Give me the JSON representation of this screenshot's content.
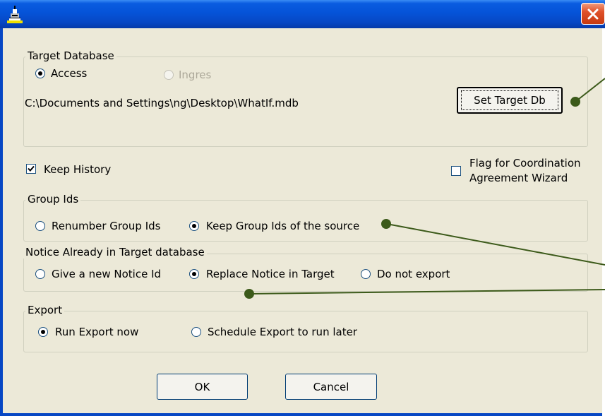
{
  "window": {
    "title": ""
  },
  "target_database": {
    "title": "Target Database",
    "access_label": "Access",
    "ingres_label": "Ingres",
    "path": "C:\\Documents and Settings\\ng\\Desktop\\WhatIf.mdb",
    "set_target_label": "Set Target Db"
  },
  "options": {
    "keep_history_label": "Keep History",
    "keep_history_checked": true,
    "flag_line1": "Flag for Coordination",
    "flag_line2": "Agreement Wizard",
    "flag_checked": false
  },
  "group_ids": {
    "title": "Group Ids",
    "renumber_label": "Renumber Group Ids",
    "keep_label": "Keep Group Ids of the source"
  },
  "notice": {
    "title": "Notice Already in Target database",
    "new_id_label": "Give a new Notice Id",
    "replace_label": "Replace Notice in Target",
    "no_export_label": "Do not export"
  },
  "export": {
    "title": "Export",
    "run_now_label": "Run Export now",
    "schedule_label": "Schedule Export to run later"
  },
  "buttons": {
    "ok_label": "OK",
    "cancel_label": "Cancel"
  },
  "colors": {
    "titlebar": "#0553d8",
    "dialog_bg": "#ece9d8",
    "callout": "#3c5a1a"
  }
}
